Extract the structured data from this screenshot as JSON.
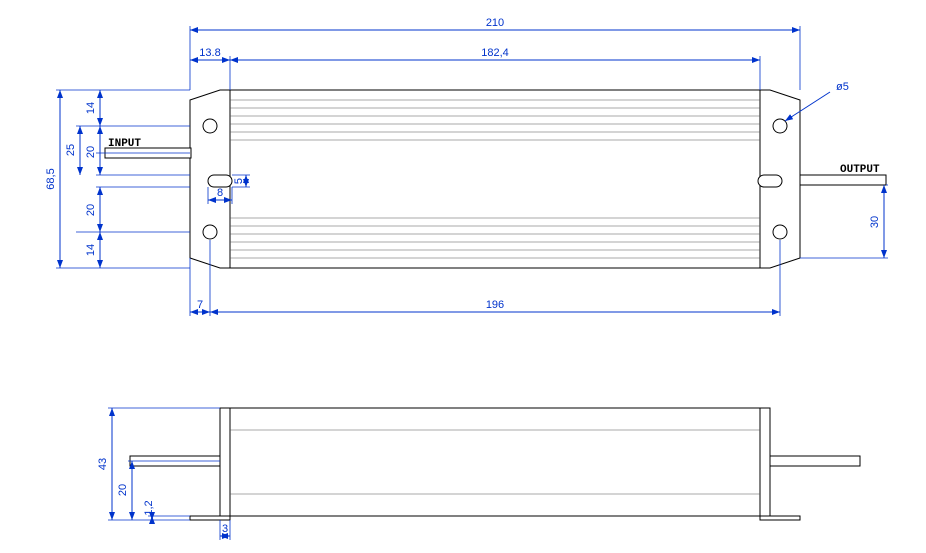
{
  "diagram": {
    "units": "mm",
    "views": [
      "top",
      "side"
    ],
    "labels": {
      "input": "INPUT",
      "output": "OUTPUT"
    },
    "dimensions": {
      "overall_length": "210",
      "finned_body_length": "182,4",
      "flange_inset": "13.8",
      "hole_center_to_center_length": "196",
      "hole_edge_offset": "7",
      "hole_diameter": "ø5",
      "overall_width": "68,5",
      "holes_vert_pitch": "25",
      "top_margin": "14",
      "cable_to_center_gap_a": "20",
      "slot_gap": "5",
      "slot_width": "8",
      "cable_to_center_gap_b": "20",
      "bottom_margin": "14",
      "output_offset": "30",
      "side_height": "43",
      "side_cable_offset": "20",
      "flange_thickness": "1,2",
      "foot_width": "3"
    }
  },
  "chart_data": {
    "type": "table",
    "title": "Mechanical dimensions drawing",
    "rows": [
      {
        "symbol": "overall_length",
        "value": 210,
        "units": "mm",
        "view": "top"
      },
      {
        "symbol": "finned_body_length",
        "value": 182.4,
        "units": "mm",
        "view": "top"
      },
      {
        "symbol": "flange_inset",
        "value": 13.8,
        "units": "mm",
        "view": "top"
      },
      {
        "symbol": "hole_center_to_center_length",
        "value": 196,
        "units": "mm",
        "view": "top"
      },
      {
        "symbol": "hole_edge_offset",
        "value": 7,
        "units": "mm",
        "view": "top"
      },
      {
        "symbol": "hole_diameter",
        "value": 5,
        "units": "mm",
        "view": "top"
      },
      {
        "symbol": "overall_width",
        "value": 68.5,
        "units": "mm",
        "view": "top"
      },
      {
        "symbol": "holes_vert_pitch",
        "value": 25,
        "units": "mm",
        "view": "top"
      },
      {
        "symbol": "top_margin",
        "value": 14,
        "units": "mm",
        "view": "top"
      },
      {
        "symbol": "cable_to_center_gap_a",
        "value": 20,
        "units": "mm",
        "view": "top"
      },
      {
        "symbol": "slot_gap",
        "value": 5,
        "units": "mm",
        "view": "top"
      },
      {
        "symbol": "slot_width",
        "value": 8,
        "units": "mm",
        "view": "top"
      },
      {
        "symbol": "cable_to_center_gap_b",
        "value": 20,
        "units": "mm",
        "view": "top"
      },
      {
        "symbol": "bottom_margin",
        "value": 14,
        "units": "mm",
        "view": "top"
      },
      {
        "symbol": "output_offset",
        "value": 30,
        "units": "mm",
        "view": "top"
      },
      {
        "symbol": "side_height",
        "value": 43,
        "units": "mm",
        "view": "side"
      },
      {
        "symbol": "side_cable_offset",
        "value": 20,
        "units": "mm",
        "view": "side"
      },
      {
        "symbol": "flange_thickness",
        "value": 1.2,
        "units": "mm",
        "view": "side"
      },
      {
        "symbol": "foot_width",
        "value": 3,
        "units": "mm",
        "view": "side"
      }
    ]
  }
}
